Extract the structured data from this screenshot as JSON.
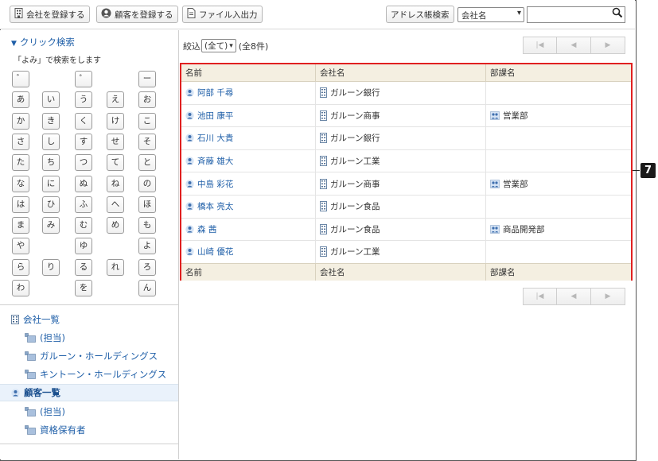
{
  "toolbar": {
    "register_company": "会社を登録する",
    "register_customer": "顧客を登録する",
    "file_io": "ファイル入出力",
    "address_search": "アドレス帳検索",
    "search_field_select": "会社名",
    "search_value": ""
  },
  "left": {
    "click_search_title": "クリック検索",
    "yomi_note": "「よみ」で検索をします",
    "kana_rows": [
      [
        "゛",
        "",
        "゜",
        "",
        "ー"
      ],
      [
        "あ",
        "い",
        "う",
        "え",
        "お"
      ],
      [
        "か",
        "き",
        "く",
        "け",
        "こ"
      ],
      [
        "さ",
        "し",
        "す",
        "せ",
        "そ"
      ],
      [
        "た",
        "ち",
        "つ",
        "て",
        "と"
      ],
      [
        "な",
        "に",
        "ぬ",
        "ね",
        "の"
      ],
      [
        "は",
        "ひ",
        "ふ",
        "へ",
        "ほ"
      ],
      [
        "ま",
        "み",
        "む",
        "め",
        "も"
      ],
      [
        "や",
        "",
        "ゆ",
        "",
        "よ"
      ],
      [
        "ら",
        "り",
        "る",
        "れ",
        "ろ"
      ],
      [
        "わ",
        "",
        "を",
        "",
        "ん"
      ]
    ],
    "tree": {
      "company_list": "会社一覧",
      "company_assigned": "(担当)",
      "company_group1": "ガルーン・ホールディングス",
      "company_group2": "キントーン・ホールディングス",
      "customer_list": "顧客一覧",
      "customer_assigned": "(担当)",
      "customer_group1": "資格保有者"
    }
  },
  "main": {
    "filter_label": "絞込",
    "filter_value": "(全て)",
    "count_text": "(全8件)",
    "columns": [
      "名前",
      "会社名",
      "部課名"
    ],
    "rows": [
      {
        "name": "阿部 千尋",
        "company": "ガルーン銀行",
        "dept": ""
      },
      {
        "name": "池田 康平",
        "company": "ガルーン商事",
        "dept": "営業部"
      },
      {
        "name": "石川 大貴",
        "company": "ガルーン銀行",
        "dept": ""
      },
      {
        "name": "斉藤 雄大",
        "company": "ガルーン工業",
        "dept": ""
      },
      {
        "name": "中島 彩花",
        "company": "ガルーン商事",
        "dept": "営業部"
      },
      {
        "name": "橋本 亮太",
        "company": "ガルーン食品",
        "dept": ""
      },
      {
        "name": "森 茜",
        "company": "ガルーン食品",
        "dept": "商品開発部"
      },
      {
        "name": "山崎 優花",
        "company": "ガルーン工業",
        "dept": ""
      }
    ],
    "callout_number": "7"
  }
}
